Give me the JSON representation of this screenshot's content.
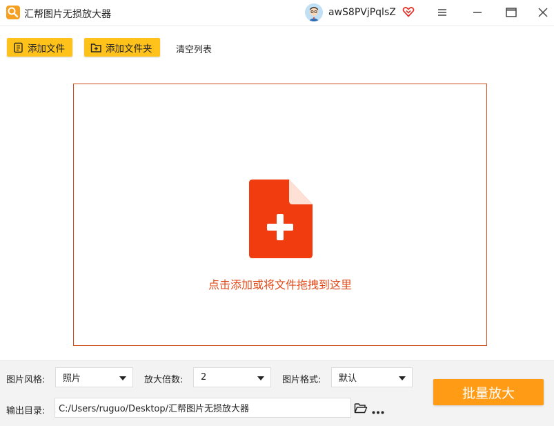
{
  "window": {
    "title": "汇帮图片无损放大器",
    "username": "awS8PVjPqlsZ",
    "icons": [
      "app-logo-icon",
      "avatar",
      "vip-heart-icon",
      "menu-icon",
      "minimize-icon",
      "maximize-icon",
      "close-icon"
    ]
  },
  "toolbar": {
    "add_file_label": "添加文件",
    "add_folder_label": "添加文件夹",
    "clear_list_label": "清空列表"
  },
  "dropzone": {
    "text": "点击添加或将文件拖拽到这里"
  },
  "settings": {
    "style_label": "图片风格:",
    "style_value": "照片",
    "scale_label": "放大倍数:",
    "scale_value": "2",
    "format_label": "图片格式:",
    "format_value": "默认",
    "output_label": "输出目录:",
    "output_path": "C:/Users/ruguo/Desktop/汇帮图片无损放大器"
  },
  "actions": {
    "batch_label": "批量放大"
  },
  "colors": {
    "accent_yellow": "#ffc21a",
    "accent_orange": "#ff9b14",
    "drop_red": "#f03c0f"
  }
}
